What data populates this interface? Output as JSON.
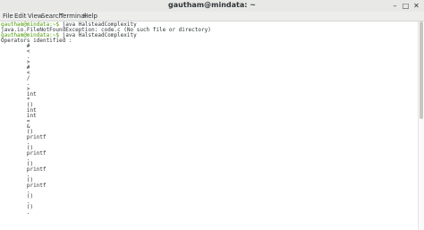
{
  "window": {
    "title": "gautham@mindata: ~",
    "controls": {
      "minimize": "–",
      "maximize": "□",
      "close": "✕"
    }
  },
  "menu": [
    "File",
    "Edit",
    "View",
    "Search",
    "Terminal",
    "Help"
  ],
  "terminal": {
    "prompt_color": "#4e9a06",
    "lines": [
      {
        "prompt": "gautham@mindata:~$",
        "text": " java HalsteadComplexity"
      },
      {
        "prompt": "",
        "text": "java.io.FileNotFoundException: code.c (No such file or directory)"
      },
      {
        "prompt": "gautham@mindata:~$",
        "text": " java HalsteadComplexity"
      },
      {
        "prompt": "",
        "text": "Operators identified :"
      },
      {
        "prompt": "",
        "text": "        #"
      },
      {
        "prompt": "",
        "text": "        <"
      },
      {
        "prompt": "",
        "text": "        ."
      },
      {
        "prompt": "",
        "text": "        >"
      },
      {
        "prompt": "",
        "text": "        #"
      },
      {
        "prompt": "",
        "text": "        <"
      },
      {
        "prompt": "",
        "text": "        /"
      },
      {
        "prompt": "",
        "text": "        ."
      },
      {
        "prompt": "",
        "text": "        >"
      },
      {
        "prompt": "",
        "text": "        int"
      },
      {
        "prompt": "",
        "text": "        *"
      },
      {
        "prompt": "",
        "text": "        ()"
      },
      {
        "prompt": "",
        "text": "        int"
      },
      {
        "prompt": "",
        "text": "        int"
      },
      {
        "prompt": "",
        "text": "        ="
      },
      {
        "prompt": "",
        "text": "        &"
      },
      {
        "prompt": "",
        "text": "        ()"
      },
      {
        "prompt": "",
        "text": "        printf"
      },
      {
        "prompt": "",
        "text": "        ."
      },
      {
        "prompt": "",
        "text": "        ()"
      },
      {
        "prompt": "",
        "text": "        printf"
      },
      {
        "prompt": "",
        "text": "        ."
      },
      {
        "prompt": "",
        "text": "        ()"
      },
      {
        "prompt": "",
        "text": "        printf"
      },
      {
        "prompt": "",
        "text": "        ."
      },
      {
        "prompt": "",
        "text": "        ()"
      },
      {
        "prompt": "",
        "text": "        printf"
      },
      {
        "prompt": "",
        "text": "        ."
      },
      {
        "prompt": "",
        "text": "        ()"
      },
      {
        "prompt": "",
        "text": "        ."
      },
      {
        "prompt": "",
        "text": "        ()"
      },
      {
        "prompt": "",
        "text": "        ."
      }
    ]
  }
}
